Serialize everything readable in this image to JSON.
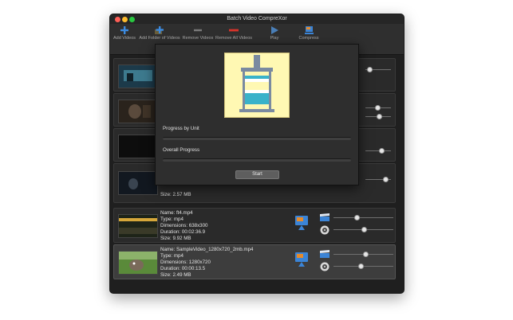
{
  "window": {
    "title": "Batch Video CompreXor"
  },
  "toolbar": {
    "add_videos": "Add Videos",
    "add_folder": "Add Folder of Videos",
    "remove_videos": "Remove Videos",
    "remove_all": "Remove All Videos",
    "play": "Play",
    "compress": "Compress"
  },
  "dialog": {
    "progress_by_unit": "Progress by Unit",
    "overall_progress": "Overall Progress",
    "start": "Start",
    "progress_by_unit_value": 0,
    "overall_progress_value": 0
  },
  "videos": [
    {
      "size_partial": "Size: 2.57 MB"
    },
    {
      "name": "Name: ft4.mp4",
      "type": "Type: mp4",
      "dimensions": "Dimensions: 638x300",
      "duration": "Duration:  00:02:36.9",
      "size": "Size: 9.92 MB"
    },
    {
      "name": "Name: SampleVideo_1280x720_2mb.mp4",
      "type": "Type: mp4",
      "dimensions": "Dimensions: 1280x720",
      "duration": "Duration:  00:00:13.5",
      "size": "Size: 2.49 MB"
    }
  ],
  "icons": {
    "add": "plus-icon",
    "remove": "minus-icon",
    "play": "play-icon",
    "compress": "compress-icon",
    "clapper": "clapper-icon",
    "audio": "speaker-icon"
  },
  "colors": {
    "add": "#3c8be0",
    "remove": "#d9342b",
    "accent": "#3b84d6"
  }
}
